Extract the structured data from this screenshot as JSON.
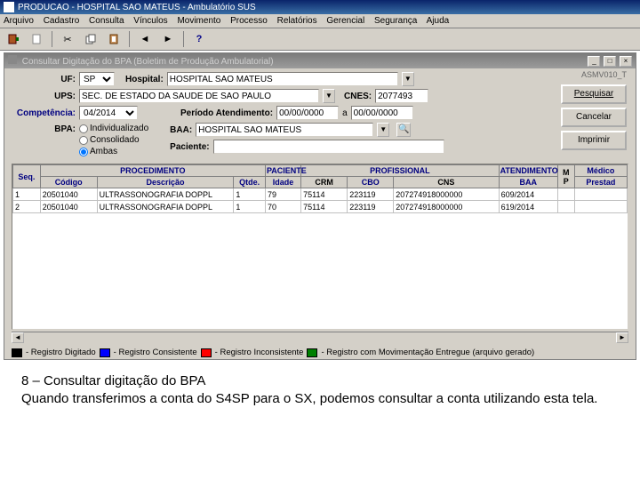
{
  "titlebar": {
    "text": "PRODUCAO - HOSPITAL SAO MATEUS - Ambulatório SUS"
  },
  "menubar": {
    "items": [
      "Arquivo",
      "Cadastro",
      "Consulta",
      "Vínculos",
      "Movimento",
      "Processo",
      "Relatórios",
      "Gerencial",
      "Segurança",
      "Ajuda"
    ]
  },
  "toolbar": {
    "icons": [
      "door",
      "blank",
      "cut",
      "copy",
      "paste",
      "sep",
      "prev",
      "next",
      "sep",
      "help"
    ]
  },
  "subwindow": {
    "title": "Consultar Digitação do BPA (Boletim de Produção Ambulatorial)"
  },
  "version": "ASMV010_T",
  "form": {
    "uf_label": "UF:",
    "uf_value": "SP",
    "hospital_label": "Hospital:",
    "hospital_value": "HOSPITAL SAO MATEUS",
    "ups_label": "UPS:",
    "ups_value": "SEC. DE ESTADO DA SAUDE DE SAO PAULO",
    "cnes_label": "CNES:",
    "cnes_value": "2077493",
    "competencia_label": "Competência:",
    "competencia_value": "04/2014",
    "periodo_label": "Período Atendimento:",
    "periodo_de": "00/00/0000",
    "periodo_a_label": "a",
    "periodo_ate": "00/00/0000",
    "bpa_label": "BPA:",
    "bpa_options": {
      "ind": "Individualizado",
      "cons": "Consolidado",
      "ambas": "Ambas"
    },
    "baa_label": "BAA:",
    "baa_value": "HOSPITAL SAO MATEUS",
    "paciente_label": "Paciente:",
    "paciente_value": ""
  },
  "buttons": {
    "pesquisar": "Pesquisar",
    "cancelar": "Cancelar",
    "imprimir": "Imprimir"
  },
  "grid": {
    "group_headers": {
      "seq": "Seq.",
      "proc": "PROCEDIMENTO",
      "pac": "PACIENTE",
      "prof": "PROFISSIONAL",
      "atend": "ATENDIMENTO",
      "mp": "M P",
      "med": "Médico"
    },
    "headers": {
      "codigo": "Código",
      "desc": "Descrição",
      "qtde": "Qtde.",
      "idade": "Idade",
      "crm": "CRM",
      "cbo": "CBO",
      "cns": "CNS",
      "baa": "BAA",
      "prestad": "Prestad"
    },
    "rows": [
      {
        "seq": "1",
        "cod": "20501040",
        "desc": "ULTRASSONOGRAFIA DOPPL",
        "qtde": "1",
        "idade": "79",
        "crm": "75114",
        "cbo": "223119",
        "cns": "207274918000000",
        "baa": "609/2014",
        "mp": "",
        "prestad": ""
      },
      {
        "seq": "2",
        "cod": "20501040",
        "desc": "ULTRASSONOGRAFIA DOPPL",
        "qtde": "1",
        "idade": "70",
        "crm": "75114",
        "cbo": "223119",
        "cns": "207274918000000",
        "baa": "619/2014",
        "mp": "",
        "prestad": ""
      }
    ]
  },
  "legend": {
    "items": [
      {
        "color": "#000000",
        "label": "- Registro Digitado"
      },
      {
        "color": "#0000ff",
        "label": "- Registro Consistente"
      },
      {
        "color": "#ff0000",
        "label": "- Registro Inconsistente"
      },
      {
        "color": "#008000",
        "label": "- Registro com Movimentação Entregue (arquivo gerado)"
      }
    ]
  },
  "caption": {
    "line1": "8 – Consultar digitação do BPA",
    "line2": "Quando transferimos a conta do S4SP para o SX, podemos consultar a conta utilizando esta tela."
  }
}
